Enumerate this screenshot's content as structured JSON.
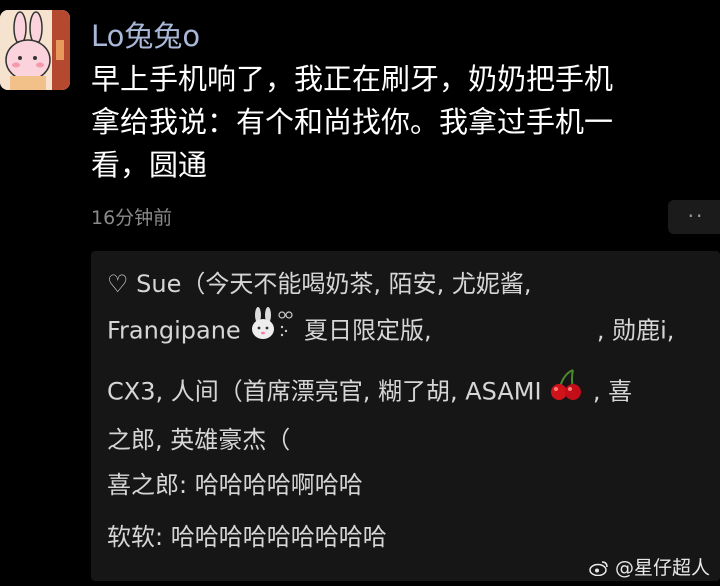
{
  "post": {
    "username": "Lo兔兔o",
    "text_line1": "早上手机响了，我正在刷牙，奶奶把手机",
    "text_line2": "拿给我说：有个和尚找你。我拿过手机一",
    "text_line3": "看，圆通",
    "time": "16分钟前",
    "more_label": "··"
  },
  "likes": {
    "heart": "♡",
    "line1": "Sue（今天不能喝奶茶, 陌安, 尤妮酱,",
    "line2a": "Frangipane",
    "line2b": "夏日限定版,",
    "line2c": ", 勋鹿i,",
    "line3a": "CX3, 人间（首席漂亮官, 糊了胡, ASAMI",
    "line3b": ", 喜",
    "line4": "之郎, 英雄豪杰（"
  },
  "replies": [
    {
      "text": "喜之郎: 哈哈哈哈啊哈哈"
    },
    {
      "text": "软软: 哈哈哈哈哈哈哈哈哈"
    }
  ],
  "watermark": "@星仔超人",
  "icons": {
    "avatar": "bunny-avatar-icon",
    "rabbit": "rabbit-emoji-icon",
    "cherry": "cherry-emoji-icon",
    "weibo": "weibo-icon"
  }
}
